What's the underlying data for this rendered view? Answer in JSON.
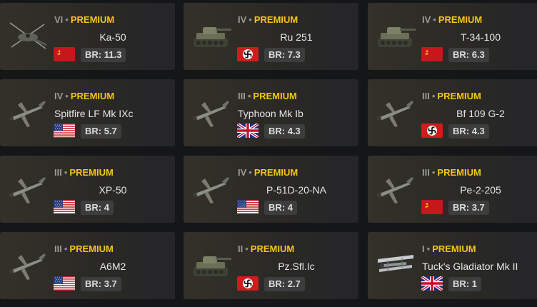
{
  "cards": [
    {
      "rank": "VI",
      "premium": "PREMIUM",
      "name": "Ka-50",
      "country": "ussr",
      "br": "BR: 11.3",
      "kind": "heli",
      "icon": "helicopter-icon"
    },
    {
      "rank": "IV",
      "premium": "PREMIUM",
      "name": "Ru 251",
      "country": "germany",
      "br": "BR: 7.3",
      "kind": "tank",
      "icon": "tank-icon"
    },
    {
      "rank": "IV",
      "premium": "PREMIUM",
      "name": "T-34-100",
      "country": "ussr",
      "br": "BR: 6.3",
      "kind": "tank",
      "icon": "tank-icon"
    },
    {
      "rank": "IV",
      "premium": "PREMIUM",
      "name": "Spitfire LF Mk IXc",
      "country": "usa",
      "br": "BR: 5.7",
      "kind": "plane",
      "icon": "aircraft-icon"
    },
    {
      "rank": "III",
      "premium": "PREMIUM",
      "name": "Typhoon Mk Ib",
      "country": "uk",
      "br": "BR: 4.3",
      "kind": "plane",
      "icon": "aircraft-icon"
    },
    {
      "rank": "III",
      "premium": "PREMIUM",
      "name": "Bf 109 G-2",
      "country": "germany",
      "br": "BR: 4.3",
      "kind": "plane",
      "icon": "aircraft-icon"
    },
    {
      "rank": "III",
      "premium": "PREMIUM",
      "name": "XP-50",
      "country": "usa",
      "br": "BR: 4",
      "kind": "plane",
      "icon": "aircraft-icon"
    },
    {
      "rank": "IV",
      "premium": "PREMIUM",
      "name": "P-51D-20-NA",
      "country": "usa",
      "br": "BR: 4",
      "kind": "plane",
      "icon": "aircraft-icon"
    },
    {
      "rank": "III",
      "premium": "PREMIUM",
      "name": "Pe-2-205",
      "country": "ussr",
      "br": "BR: 3.7",
      "kind": "plane",
      "icon": "aircraft-icon"
    },
    {
      "rank": "III",
      "premium": "PREMIUM",
      "name": "A6M2",
      "country": "usa",
      "br": "BR: 3.7",
      "kind": "plane",
      "icon": "aircraft-icon"
    },
    {
      "rank": "II",
      "premium": "PREMIUM",
      "name": "Pz.Sfl.Ic",
      "country": "germany",
      "br": "BR: 2.7",
      "kind": "tank",
      "icon": "tank-icon"
    },
    {
      "rank": "I",
      "premium": "PREMIUM",
      "name": "Tuck's Gladiator Mk II",
      "country": "uk",
      "br": "BR: 1",
      "kind": "biplane",
      "icon": "biplane-icon"
    }
  ],
  "colors": {
    "premium": "#f5c518",
    "card_bg": "#2e2c27",
    "br_bg": "#3d3d3d",
    "page_bg": "#151618"
  }
}
